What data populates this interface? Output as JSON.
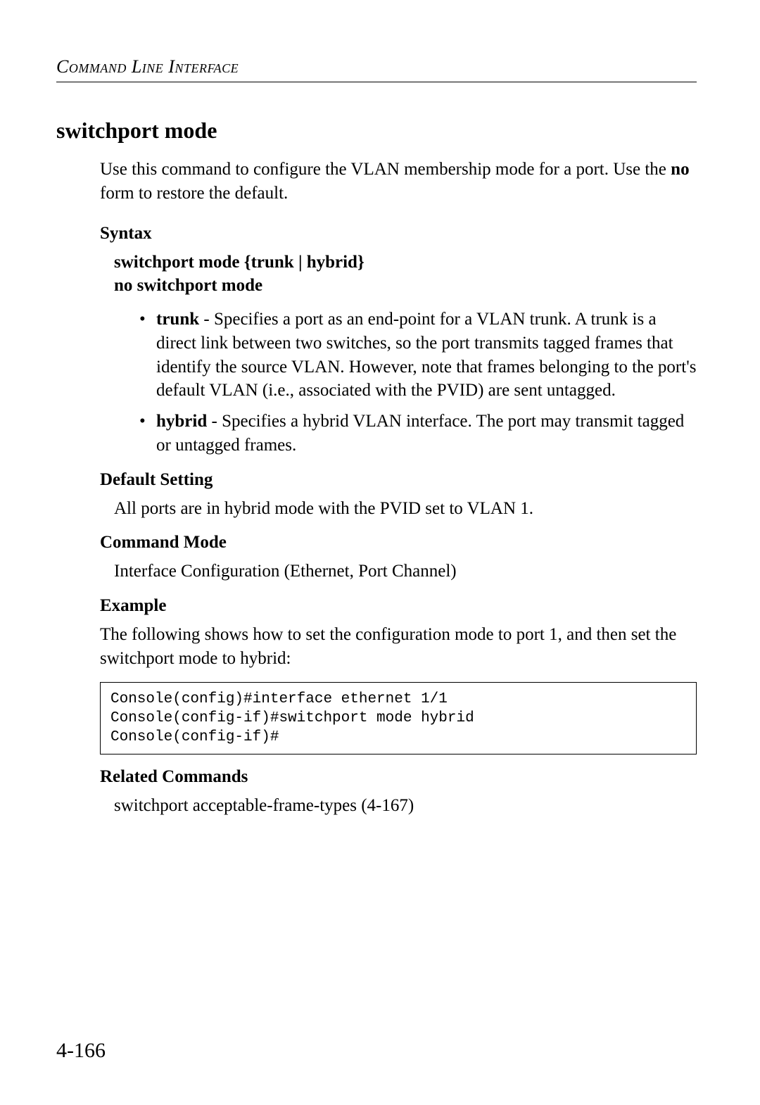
{
  "header": {
    "running_head": "Command Line Interface"
  },
  "section": {
    "title": "switchport mode",
    "intro_pre": "Use this command to configure the VLAN membership mode for a port. Use the ",
    "intro_bold": "no",
    "intro_post": " form to restore the default."
  },
  "syntax": {
    "label": "Syntax",
    "line1_cmd": "switchport mode",
    "line1_args": " {trunk | hybrid}",
    "line2": "no switchport mode",
    "bullets": [
      {
        "term": "trunk",
        "desc": " - Specifies a port as an end-point for a VLAN trunk. A trunk is a direct link between two switches, so the port transmits tagged frames that identify the source VLAN. However, note that frames belonging to the port's default VLAN (i.e., associated with the PVID) are sent untagged."
      },
      {
        "term": "hybrid",
        "desc": " - Specifies a hybrid VLAN interface. The port may transmit tagged or untagged frames."
      }
    ]
  },
  "default_setting": {
    "label": "Default Setting",
    "text": "All ports are in hybrid mode with the PVID set to VLAN 1."
  },
  "command_mode": {
    "label": "Command Mode",
    "text": "Interface Configuration (Ethernet, Port Channel)"
  },
  "example": {
    "label": "Example",
    "intro": "The following shows how to set the configuration mode to port 1, and then set the switchport mode to hybrid:",
    "code": "Console(config)#interface ethernet 1/1\nConsole(config-if)#switchport mode hybrid\nConsole(config-if)#"
  },
  "related": {
    "label": "Related Commands",
    "text": "switchport acceptable-frame-types (4-167)"
  },
  "page_number": "4-166"
}
